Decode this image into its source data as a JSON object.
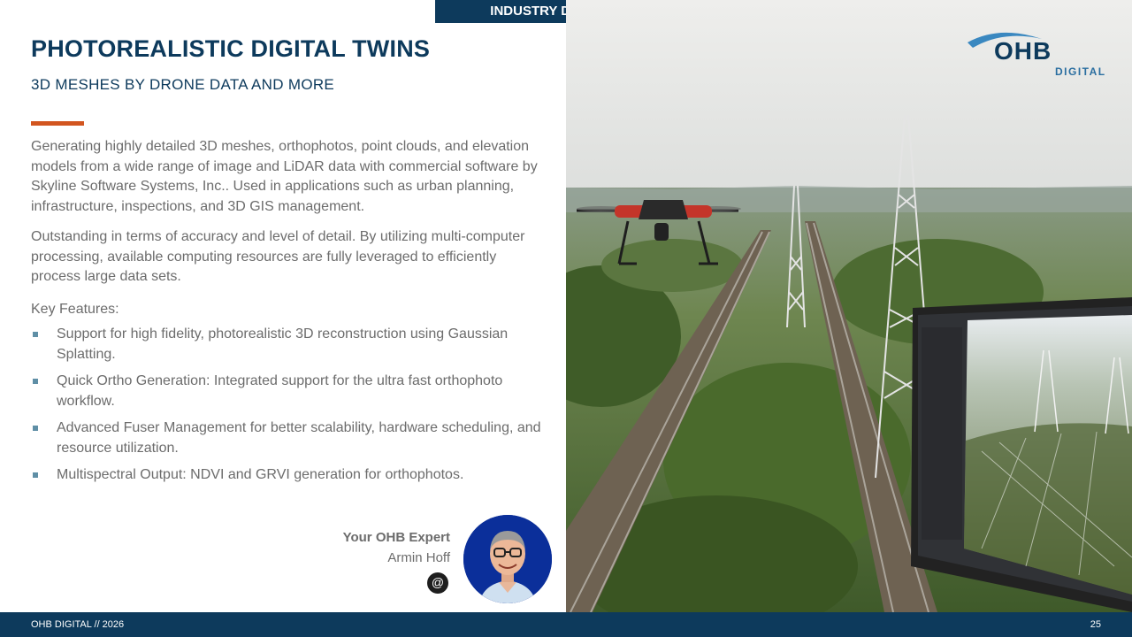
{
  "header": {
    "tag": "INDUSTRY Digital Twins",
    "title": "PHOTOREALISTIC DIGITAL TWINS",
    "subtitle": "3D MESHES BY DRONE DATA AND MORE"
  },
  "logo": {
    "primary": "OHB",
    "secondary": "DIGITAL"
  },
  "content": {
    "paragraphs": [
      "Generating highly detailed 3D meshes, orthophotos, point clouds, and elevation models from a wide range of image and LiDAR data with commercial software by Skyline Software Systems, Inc.. Used in applications such as urban planning, infrastructure, inspections, and 3D GIS management.",
      "Outstanding in terms of accuracy and level of detail. By utilizing multi-computer processing, available computing resources are fully leveraged to efficiently process large data sets."
    ],
    "features_heading": "Key Features:",
    "features": [
      "Support for high fidelity, photorealistic 3D reconstruction using Gaussian Splatting.",
      "Quick Ortho Generation: Integrated support for the ultra fast orthophoto workflow.",
      "Advanced Fuser Management for better scalability, hardware scheduling, and resource utilization.",
      "Multispectral Output: NDVI and GRVI generation for orthophotos."
    ]
  },
  "expert": {
    "title": "Your OHB Expert",
    "name": "Armin Hoff",
    "contact_symbol": "@"
  },
  "footer": {
    "left": "OHB DIGITAL // 2026",
    "page": "25"
  },
  "colors": {
    "navy": "#0d3a5c",
    "accent": "#d2551f",
    "bullet": "#5f8fa6"
  }
}
